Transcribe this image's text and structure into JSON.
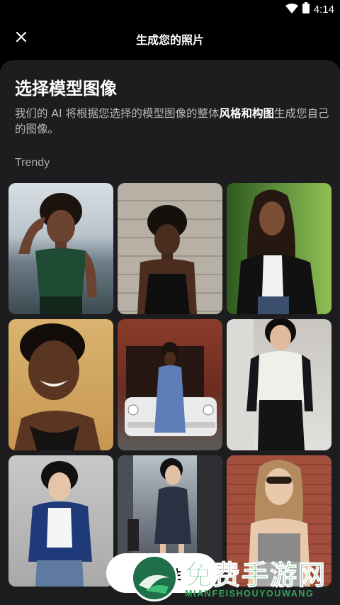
{
  "status_bar": {
    "time": "4:14",
    "icons": [
      "wifi-icon",
      "battery-icon"
    ]
  },
  "top_bar": {
    "title": "生成您的照片",
    "close_icon": "close-icon"
  },
  "sheet": {
    "title": "选择模型图像",
    "desc_prefix": "我们的 AI 将根据您选择的模型图像的整体",
    "desc_bold": "风格和构图",
    "desc_suffix": "生成您自己的图像。",
    "section_label": "Trendy"
  },
  "grid": {
    "images": [
      {
        "name": "model-image-1",
        "description": "woman in green top at beach"
      },
      {
        "name": "model-image-2",
        "description": "woman in black top by stone wall"
      },
      {
        "name": "model-image-3",
        "description": "woman in leather jacket outdoors"
      },
      {
        "name": "model-image-4",
        "description": "smiling woman portrait"
      },
      {
        "name": "model-image-5",
        "description": "woman in blue dress by vintage car"
      },
      {
        "name": "model-image-6",
        "description": "woman in white sweater and leather pants"
      },
      {
        "name": "model-image-7",
        "description": "woman in blue jacket studio"
      },
      {
        "name": "model-image-8",
        "description": "woman in dark dress on city street"
      },
      {
        "name": "model-image-9",
        "description": "woman in sunglasses by brick wall"
      }
    ]
  },
  "fab": {
    "label": "性"
  },
  "watermark": {
    "text": "免费手游网",
    "sub": "MIANFEISHOUYOUWANG"
  },
  "colors": {
    "background": "#000000",
    "sheet": "#1d1d1f",
    "fab": "#ffffff",
    "watermark": "#2fa85c"
  }
}
